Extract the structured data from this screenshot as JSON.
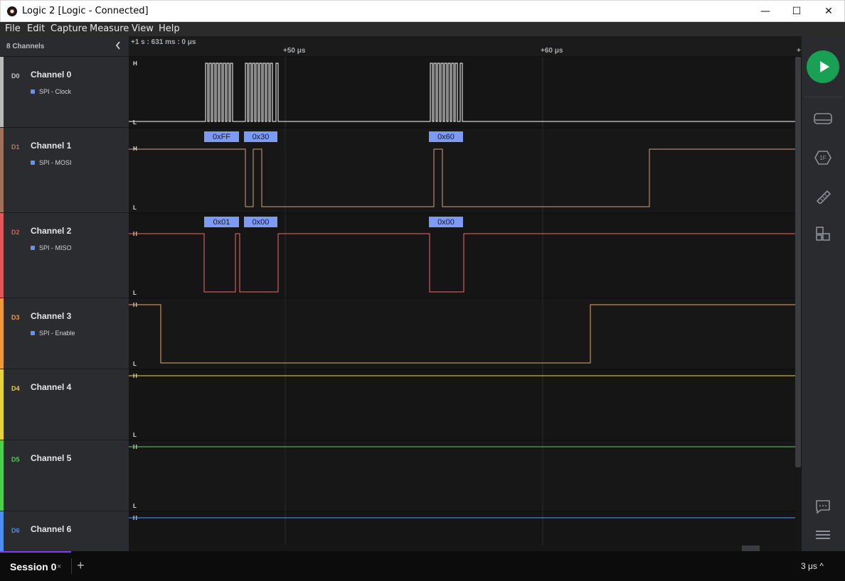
{
  "window": {
    "title": "Logic 2 [Logic - Connected]",
    "minimize": "—",
    "maximize": "☐",
    "close": "✕"
  },
  "menu": [
    "File",
    "Edit",
    "Capture",
    "Measure",
    "View",
    "Help"
  ],
  "sidebar": {
    "header": "8 Channels",
    "collapse_icon": "chevron-left-icon"
  },
  "channels": [
    {
      "id": "D0",
      "name": "Channel 0",
      "analyzer": "SPI - Clock",
      "color": "#b8b8b8"
    },
    {
      "id": "D1",
      "name": "Channel 1",
      "analyzer": "SPI - MOSI",
      "color": "#a0705a"
    },
    {
      "id": "D2",
      "name": "Channel 2",
      "analyzer": "SPI - MISO",
      "color": "#e05858"
    },
    {
      "id": "D3",
      "name": "Channel 3",
      "analyzer": "SPI - Enable",
      "color": "#ec9a3a"
    },
    {
      "id": "D4",
      "name": "Channel 4",
      "analyzer": "",
      "color": "#e8d23a"
    },
    {
      "id": "D5",
      "name": "Channel 5",
      "analyzer": "",
      "color": "#4ccf4c"
    },
    {
      "id": "D6",
      "name": "Channel 6",
      "analyzer": "",
      "color": "#4a8ef0"
    }
  ],
  "timeline": {
    "origin": "+1 s : 631 ms : 0 μs",
    "ticks": [
      "+50 μs",
      "+60 μs",
      "+"
    ]
  },
  "level_labels": {
    "high": "H",
    "low": "L"
  },
  "decodes": {
    "mosi": [
      "0xFF",
      "0x30",
      "0x60"
    ],
    "miso": [
      "0x01",
      "0x00",
      "0x00"
    ]
  },
  "session": {
    "tab": "Session 0",
    "close": "×",
    "add": "+"
  },
  "zoom": "3 μs ^",
  "toolbar_icons": [
    "play-icon",
    "device-icon",
    "analyzer-icon",
    "measure-icon",
    "extensions-icon",
    "feedback-icon",
    "menu-icon"
  ]
}
